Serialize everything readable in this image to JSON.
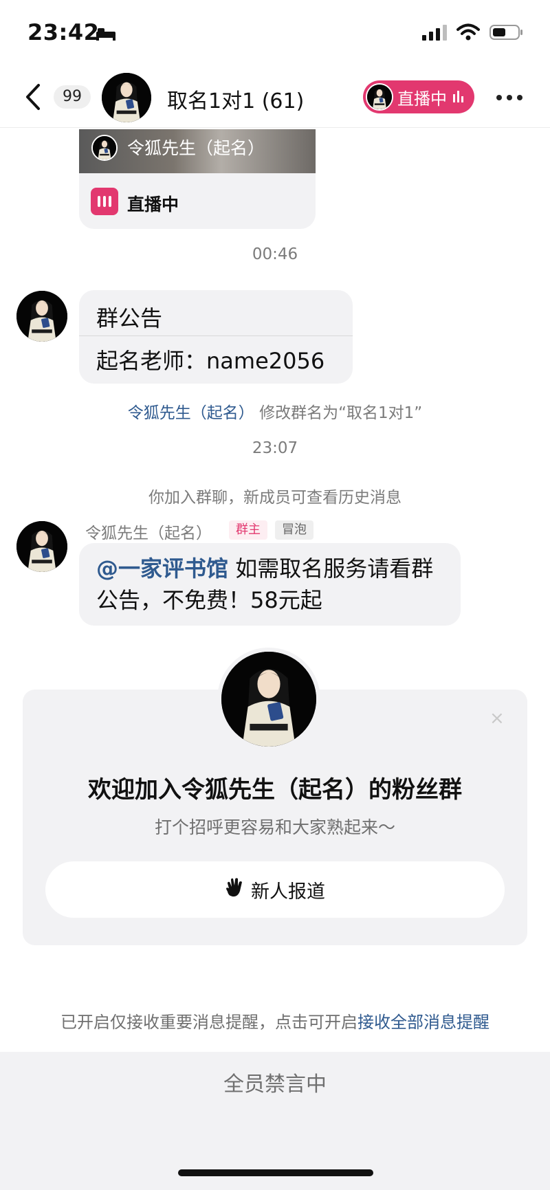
{
  "status_bar": {
    "time": "23:42"
  },
  "header": {
    "unread_count": "99",
    "title": "取名1对1 (61)",
    "live_label": "直播中"
  },
  "live_card": {
    "streamer_name": "令狐先生（起名）",
    "status": "直播中"
  },
  "messages": {
    "time_1": "00:46",
    "notice_title": "群公告",
    "notice_body": "起名老师：name2056",
    "rename_actor": "令狐先生（起名）",
    "rename_text": " 修改群名为“取名1对1”",
    "time_2": "23:07",
    "join_notice": "你加入群聊，新成员可查看历史消息",
    "sender_name": "令狐先生（起名）",
    "tag_owner": "群主",
    "tag_bubble": "冒泡",
    "mention": "@一家评书馆",
    "message_text": " 如需取名服务请看群公告，不免费！58元起"
  },
  "welcome": {
    "title": "欢迎加入令狐先生（起名）的粉丝群",
    "subtitle": "打个招呼更容易和大家熟起来～",
    "button_label": "新人报道",
    "close": "×"
  },
  "notify": {
    "prefix": "已开启仅接收重要消息提醒，点击可开启",
    "link": "接收全部消息提醒"
  },
  "footer": {
    "mute_text": "全员禁言中"
  },
  "colors": {
    "accent_pink": "#e2386f",
    "link_blue": "#2f5a8f",
    "bubble_bg": "#f2f2f4"
  }
}
